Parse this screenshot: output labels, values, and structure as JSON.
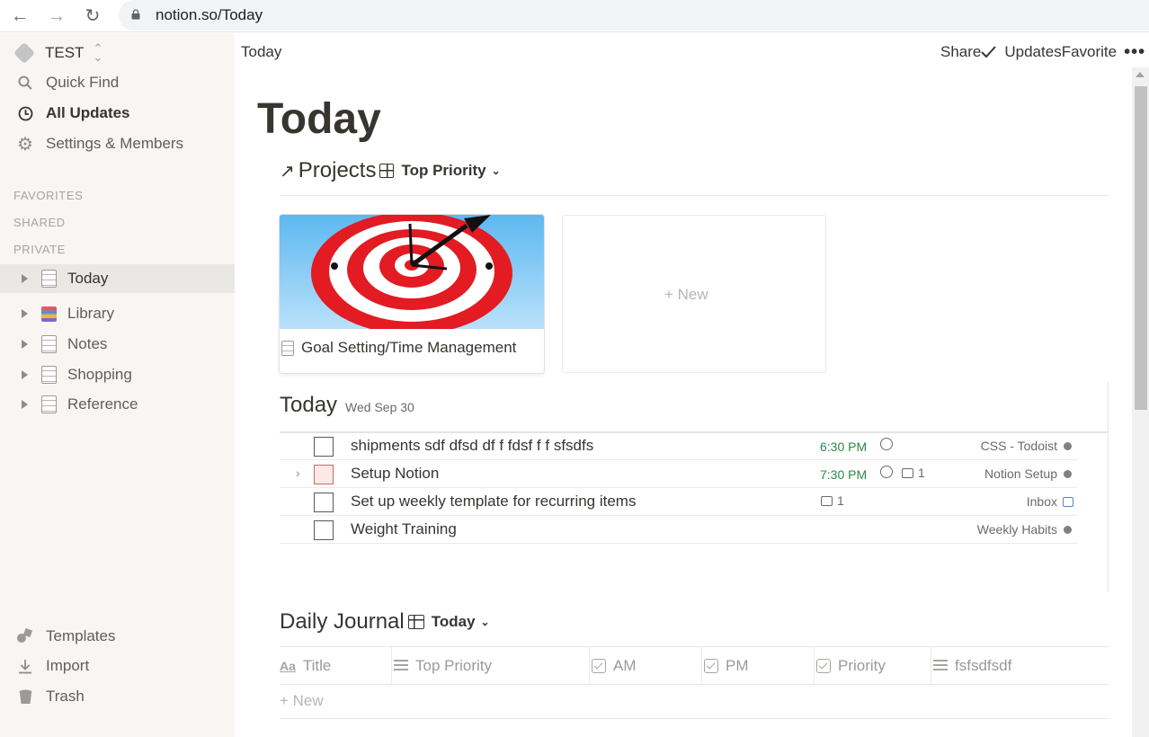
{
  "browser": {
    "url": "notion.so/Today",
    "back_icon": "←",
    "forward_icon": "→",
    "reload_icon": "↻"
  },
  "sidebar": {
    "workspace": "TEST",
    "links": [
      {
        "label": "Quick Find",
        "icon": "search-icon"
      },
      {
        "label": "All Updates",
        "icon": "clock-icon"
      },
      {
        "label": "Settings & Members",
        "icon": "gear-icon"
      }
    ],
    "sections": [
      "FAVORITES",
      "SHARED",
      "PRIVATE"
    ],
    "pages": [
      {
        "label": "Today",
        "icon": "page-icon",
        "active": true
      },
      {
        "label": "Library",
        "icon": "books-icon"
      },
      {
        "label": "Notes",
        "icon": "page-icon"
      },
      {
        "label": "Shopping",
        "icon": "page-icon"
      },
      {
        "label": "Reference",
        "icon": "page-icon"
      }
    ],
    "footer": [
      {
        "label": "Templates",
        "icon": "shapes-icon"
      },
      {
        "label": "Import",
        "icon": "download-icon"
      },
      {
        "label": "Trash",
        "icon": "trash-icon"
      }
    ]
  },
  "topbar": {
    "breadcrumb": "Today",
    "share": "Share",
    "updates": "Updates",
    "favorite": "Favorite",
    "more": "•••"
  },
  "page": {
    "title": "Today",
    "projects": {
      "title": "Projects",
      "view": "Top Priority",
      "card_title": "Goal Setting/Time Management",
      "new_label": "+ New"
    },
    "today": {
      "title": "Today",
      "date": "Wed Sep 30",
      "tasks": [
        {
          "text": "shipments sdf dfsd df f fdsf f f sfsdfs",
          "time": "6:30 PM",
          "comments": "",
          "project": "CSS - Todoist"
        },
        {
          "text": "Setup Notion",
          "time": "7:30 PM",
          "comments": "1",
          "project": "Notion Setup"
        },
        {
          "text": "Set up weekly template for recurring items",
          "time": "",
          "comments": "1",
          "project": "Inbox"
        },
        {
          "text": "Weight Training",
          "time": "",
          "comments": "",
          "project": "Weekly Habits"
        }
      ]
    },
    "journal": {
      "title": "Daily Journal",
      "view": "Today",
      "columns": [
        "Title",
        "Top Priority",
        "AM",
        "PM",
        "Priority",
        "fsfsdfsdf"
      ],
      "new_label": "+ New"
    }
  },
  "colors": {
    "sidebar_bg": "#f7f6f3",
    "time_green": "#2a8a4a",
    "text": "#37352f"
  }
}
